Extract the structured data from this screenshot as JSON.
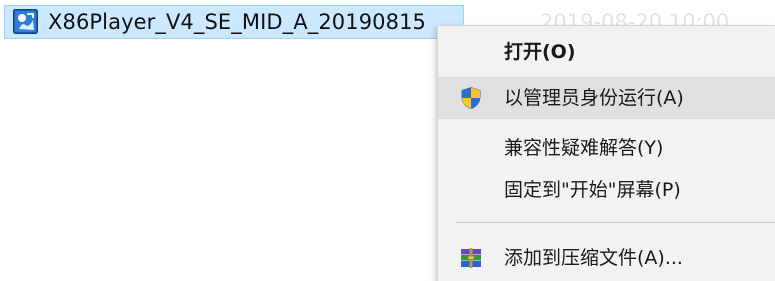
{
  "file": {
    "name": "X86Player_V4_SE_MID_A_20190815",
    "date": "2019-08-20 10:00",
    "icon": "app-icon"
  },
  "context_menu": {
    "items": [
      {
        "label": "打开(O)",
        "bold": true,
        "icon": ""
      },
      {
        "label": "以管理员身份运行(A)",
        "bold": false,
        "icon": "uac-shield-icon"
      },
      {
        "label": "兼容性疑难解答(Y)",
        "bold": false,
        "icon": ""
      },
      {
        "label": "固定到\"开始\"屏幕(P)",
        "bold": false,
        "icon": ""
      },
      {
        "label": "添加到压缩文件(A)...",
        "bold": false,
        "icon": "winrar-archive-icon"
      }
    ]
  },
  "colors": {
    "selection_bg": "#cce8ff",
    "menu_bg": "#f2f2f2",
    "menu_hover": "#e0e0e0"
  }
}
